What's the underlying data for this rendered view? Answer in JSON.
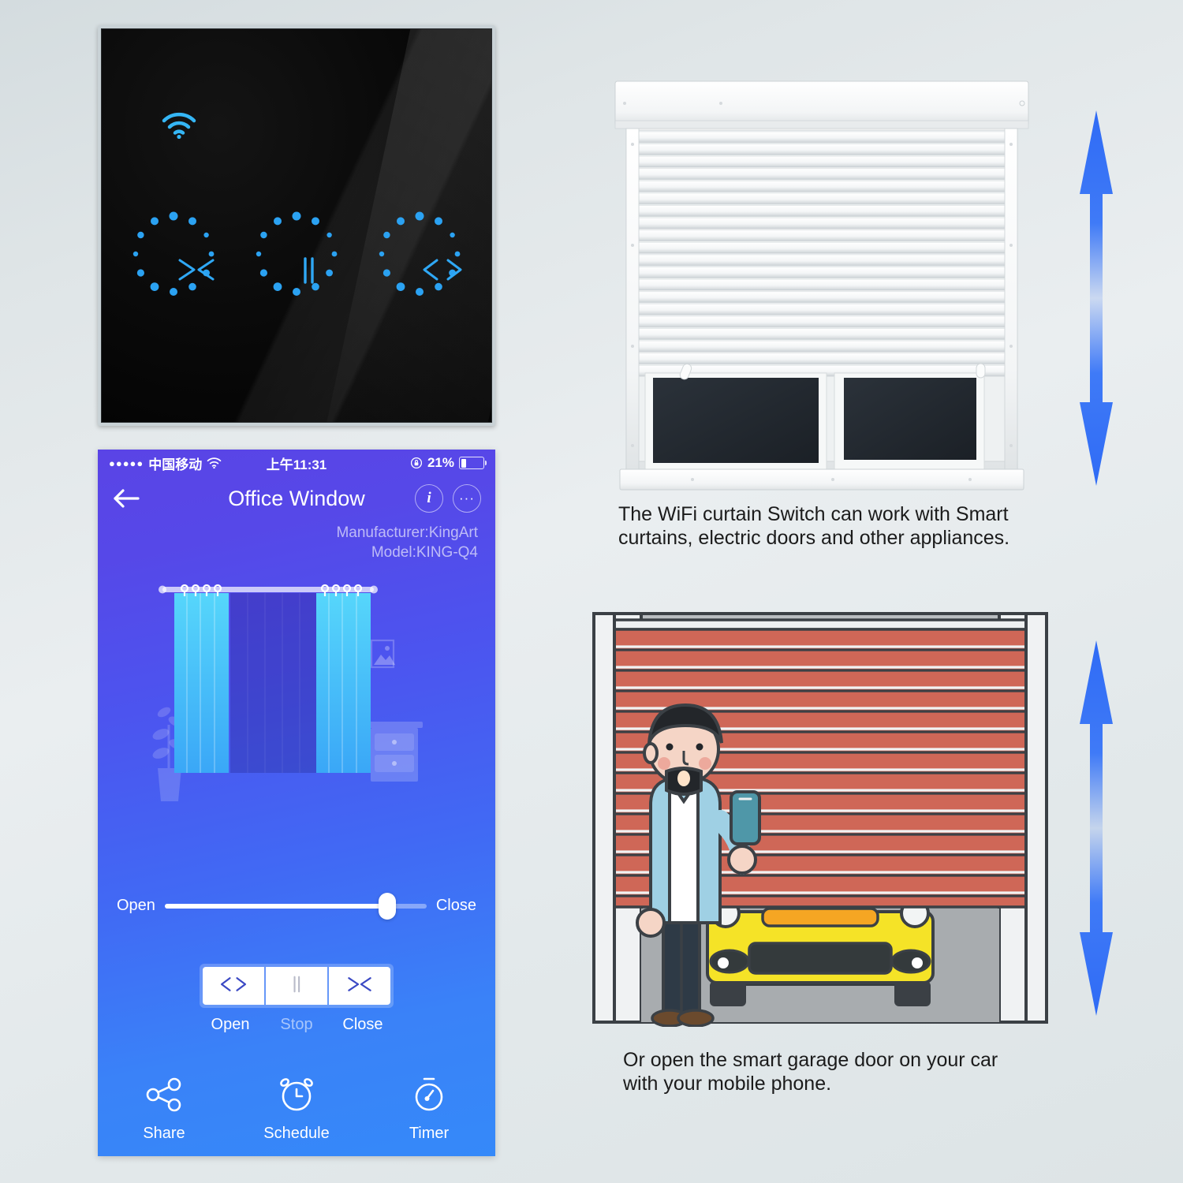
{
  "device_panel": {
    "name": "wifi-curtain-touch-switch",
    "wifi_icon": "wifi-icon",
    "buttons": [
      {
        "key": "close",
        "icon": "close-curtain-icon",
        "glyph": "><"
      },
      {
        "key": "stop",
        "icon": "stop-icon",
        "glyph": "||"
      },
      {
        "key": "open",
        "icon": "open-curtain-icon",
        "glyph": "<>"
      }
    ],
    "led_color": "#2fa8f5"
  },
  "phone": {
    "statusbar": {
      "signal_dots": "●●●●●",
      "carrier": "中国移动",
      "wifi_icon": "wifi-icon",
      "time": "上午11:31",
      "lock_icon": "rotation-lock-icon",
      "battery_percent": "21%",
      "battery_level": 21
    },
    "navbar": {
      "back_icon": "back-arrow-icon",
      "title": "Office Window",
      "info_label": "i",
      "more_label": "···"
    },
    "meta": {
      "manufacturer": "Manufacturer:KingArt",
      "model": "Model:KING-Q4"
    },
    "slider": {
      "left_label": "Open",
      "right_label": "Close",
      "value": 85
    },
    "controls": {
      "buttons": [
        {
          "key": "open",
          "icon": "open-curtain-icon",
          "glyph": "<>",
          "label": "Open",
          "dim": false
        },
        {
          "key": "stop",
          "icon": "stop-icon",
          "glyph": "||",
          "label": "Stop",
          "dim": true
        },
        {
          "key": "close",
          "icon": "close-curtain-icon",
          "glyph": "><",
          "label": "Close",
          "dim": false
        }
      ]
    },
    "bottombar": [
      {
        "key": "share",
        "icon": "share-icon",
        "label": "Share"
      },
      {
        "key": "schedule",
        "icon": "alarm-clock-icon",
        "label": "Schedule"
      },
      {
        "key": "timer",
        "icon": "stopwatch-icon",
        "label": "Timer"
      }
    ],
    "gradient": {
      "from": "#5a44e6",
      "to": "#3589f9"
    }
  },
  "right_column": {
    "window_image_alt": "white-roller-shutter-window",
    "caption_1": "The WiFi curtain Switch can work with Smart curtains, electric doors and other appliances.",
    "garage_image_alt": "man-with-phone-opening-garage-door",
    "caption_2": "Or open the smart garage door on your car with your mobile phone.",
    "arrow_color": "#2f6bf5"
  }
}
